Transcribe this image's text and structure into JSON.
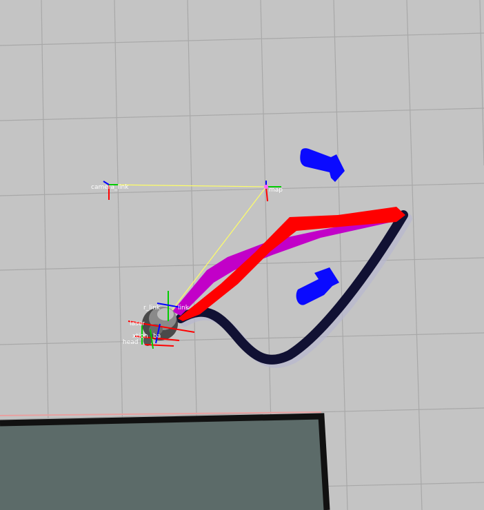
{
  "viewport": {
    "background": "#c4c4c4",
    "grid_color": "#a9a9a9",
    "map_color": "#5c6b69",
    "wall_color": "#111111"
  },
  "frames": {
    "camera_link": "camera_link",
    "map": "map",
    "base_link": "link",
    "xtion": "xtion",
    "head": "head",
    "laser": "laser",
    "labels_misc": [
      "ba",
      "xtion",
      "head",
      "r_link",
      "gripper"
    ]
  },
  "paths": {
    "global_plan_color": "#ff0000",
    "local_plan_color": "#cc00cc",
    "trajectory_color": "#111133"
  },
  "markers": {
    "goal_arrow_color": "#0a0aff",
    "connector_color": "#ffff66"
  }
}
